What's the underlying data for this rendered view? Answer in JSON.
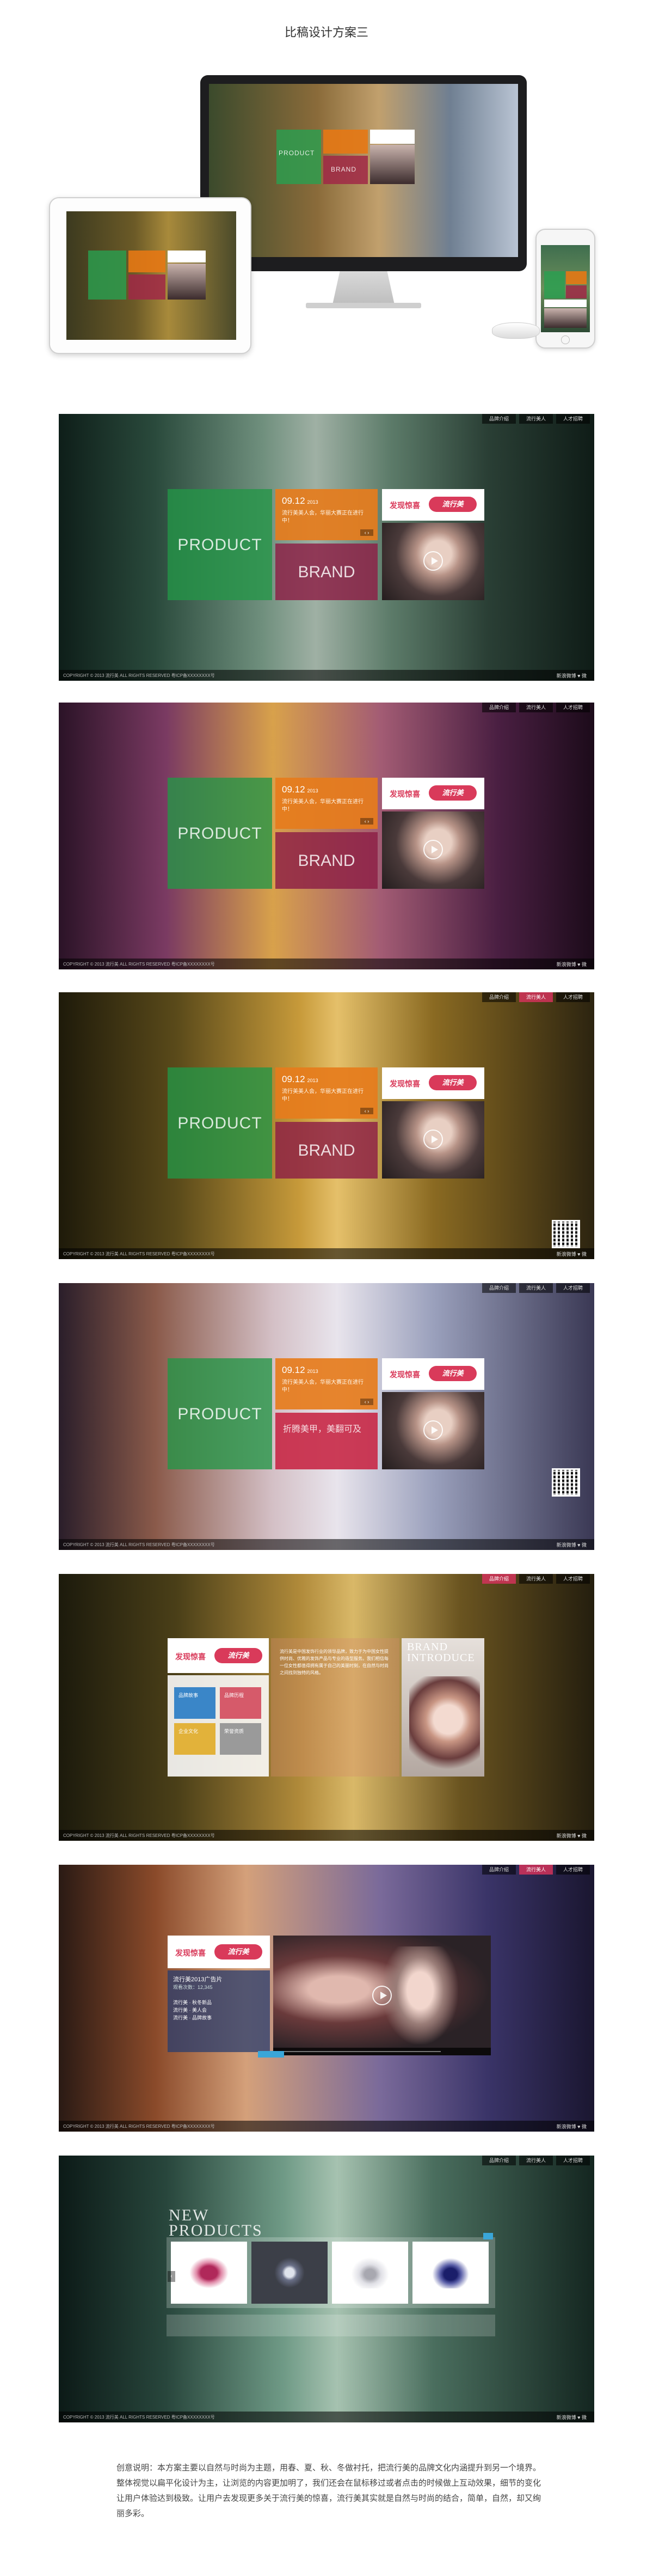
{
  "page": {
    "title": "比稿设计方案三",
    "description": "创意说明：本方案主要以自然与时尚为主题，用春、夏、秋、冬做衬托，把流行美的品牌文化内涵提升到另一个境界。整体视觉以扁平化设计为主，让浏览的内容更加明了，我们还会在鼠标移过或者点击的时候做上互动效果，细节的变化让用户体验达到极致。让用户去发现更多关于流行美的惊喜，流行美其实就是自然与时尚的结合，简单，自然，却又绚丽多彩。"
  },
  "nav": {
    "items": [
      "品牌介绍",
      "流行美人",
      "人才招聘"
    ]
  },
  "tiles": {
    "product": "PRODUCT",
    "brand": "BRAND",
    "news_date": "09.12",
    "news_year": "2013",
    "news_text": "流行美美人会，华丽大赛正在进行中！",
    "news_arrow": "‹ ›",
    "brand_cn": "折腾美甲，美翻可及",
    "logo_text": "发现惊喜",
    "logo_badge": "流行美"
  },
  "footer": {
    "copy": "COPYRIGHT © 2013 流行美 ALL RIGHTS RESERVED  粤ICP备XXXXXXXX号",
    "right": "新浪微博  ♥  微"
  },
  "intro": {
    "brand_title_1": "BRAND",
    "brand_title_2": "INTRODUCE",
    "grid": [
      "品牌故事",
      "品牌历程",
      "企业文化",
      "荣誉资质"
    ],
    "text": "流行美是中国发饰行业的领导品牌，致力于为中国女性提供时尚、优雅的发饰产品与专业的造型服务。我们相信每一位女性都值得拥有属于自己的美丽时刻，在自然与时尚之间找到独特的风格。"
  },
  "video": {
    "list_title": "流行美2013广告片",
    "list_sub": "观看次数：12,345",
    "list_items": [
      "流行美 · 秋冬新品",
      "流行美 · 美人会",
      "流行美 · 品牌故事"
    ]
  },
  "new_products": {
    "title_1": "NEW",
    "title_2": "PRODUCTS"
  },
  "colors": {
    "green": "#229646",
    "orange": "#e67c1c",
    "magenta": "#8c1e46",
    "accent_blue": "#3aa6d8",
    "logo_red": "#d93a5a"
  }
}
